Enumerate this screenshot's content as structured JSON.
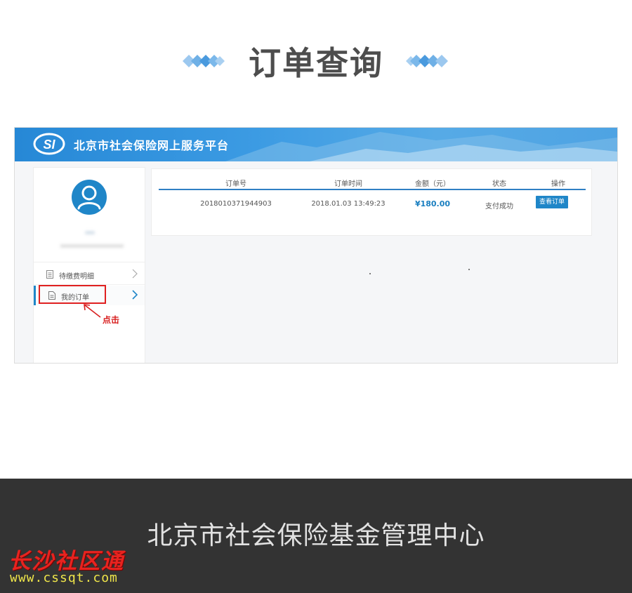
{
  "header": {
    "title": "订单查询"
  },
  "portal": {
    "title": "北京市社会保险网上服务平台",
    "logo_text": "SI"
  },
  "sidebar": {
    "user_name": "***",
    "user_id": "********************",
    "items": [
      {
        "label": "待缴费明细",
        "icon": "list-icon"
      },
      {
        "label": "我的订单",
        "icon": "document-icon",
        "active": true
      }
    ],
    "annotation": "点击"
  },
  "orders": {
    "columns": [
      "订单号",
      "订单时间",
      "金额（元）",
      "状态",
      "操作"
    ],
    "rows": [
      {
        "order_no": "2018010371944903",
        "order_time": "2018.01.03 13:49:23",
        "amount": "¥180.00",
        "status": "支付成功",
        "action": "查看订单"
      }
    ]
  },
  "footer": {
    "title": "北京市社会保险基金管理中心",
    "watermark_brand": "长沙社区通",
    "watermark_url": "www.cssqt.com"
  },
  "colors": {
    "accent": "#1f86c8",
    "banner": "#3c9be3",
    "highlight": "#e02020",
    "footer_bg": "#333333"
  }
}
